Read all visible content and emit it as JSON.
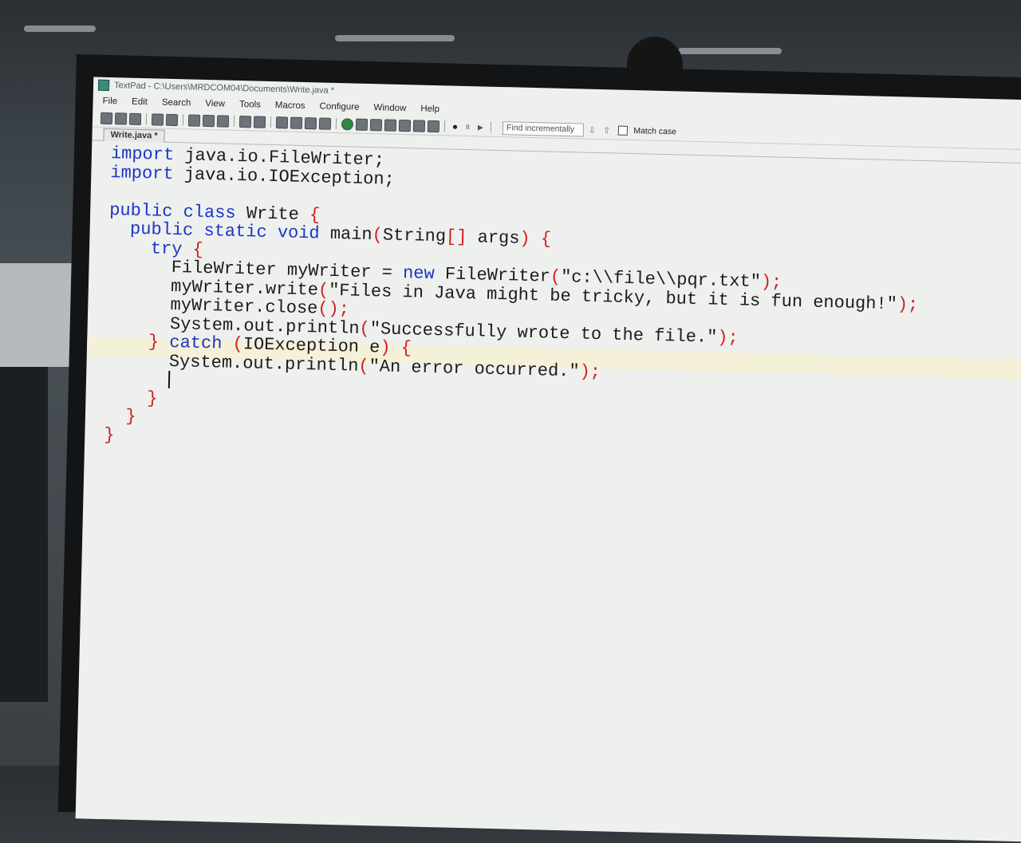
{
  "window": {
    "title": "TextPad - C:\\Users\\MRDCOM04\\Documents\\Write.java *"
  },
  "menu": [
    "File",
    "Edit",
    "Search",
    "View",
    "Tools",
    "Macros",
    "Configure",
    "Window",
    "Help"
  ],
  "find": {
    "placeholder": "Find incrementally",
    "match_case_label": "Match case"
  },
  "tab": {
    "label": "Write.java *"
  },
  "code": {
    "l1a": "import",
    "l1b": " java.io.FileWriter;",
    "l2a": "import",
    "l2b": " java.io.IOException;",
    "l4a": "public class",
    "l4b": " Write ",
    "l4c": "{",
    "l5a": "public static void",
    "l5b": " main",
    "l5c": "(",
    "l5d": "String",
    "l5e": "[]",
    "l5f": " args",
    "l5g": ")",
    "l5h": " {",
    "l6a": "try",
    "l6b": " {",
    "l7a": "FileWriter myWriter = ",
    "l7b": "new",
    "l7c": " FileWriter",
    "l7d": "(",
    "l7e": "\"c:\\\\file\\\\pqr.txt\"",
    "l7f": ");",
    "l8a": "myWriter.write",
    "l8b": "(",
    "l8c": "\"Files in Java might be tricky, but it is fun enough!\"",
    "l8d": ");",
    "l9a": "myWriter.close",
    "l9b": "();",
    "l10a": "System.out.println",
    "l10b": "(",
    "l10c": "\"Successfully wrote to the file.\"",
    "l10d": ");",
    "l11a": "}",
    "l11b": " catch",
    "l11c": " (",
    "l11d": "IOException e",
    "l11e": ")",
    "l11f": " {",
    "l12a": "System.out.println",
    "l12b": "(",
    "l12c": "\"An error occurred.\"",
    "l12d": ");",
    "l14": "}",
    "l15": "}",
    "l16": "}"
  },
  "colors": {
    "keyword": "#1c35c8",
    "punctuation": "#d01e1e",
    "text": "#1b1b1b",
    "current_line": "#f5f0d8"
  },
  "icons": [
    "new-file-icon",
    "open-folder-icon",
    "save-icon",
    "print-icon",
    "cut-icon",
    "copy-icon",
    "paste-icon",
    "undo-icon",
    "redo-icon",
    "globe-icon",
    "spellcheck-icon",
    "sort-icon",
    "find-icon",
    "replace-icon"
  ]
}
